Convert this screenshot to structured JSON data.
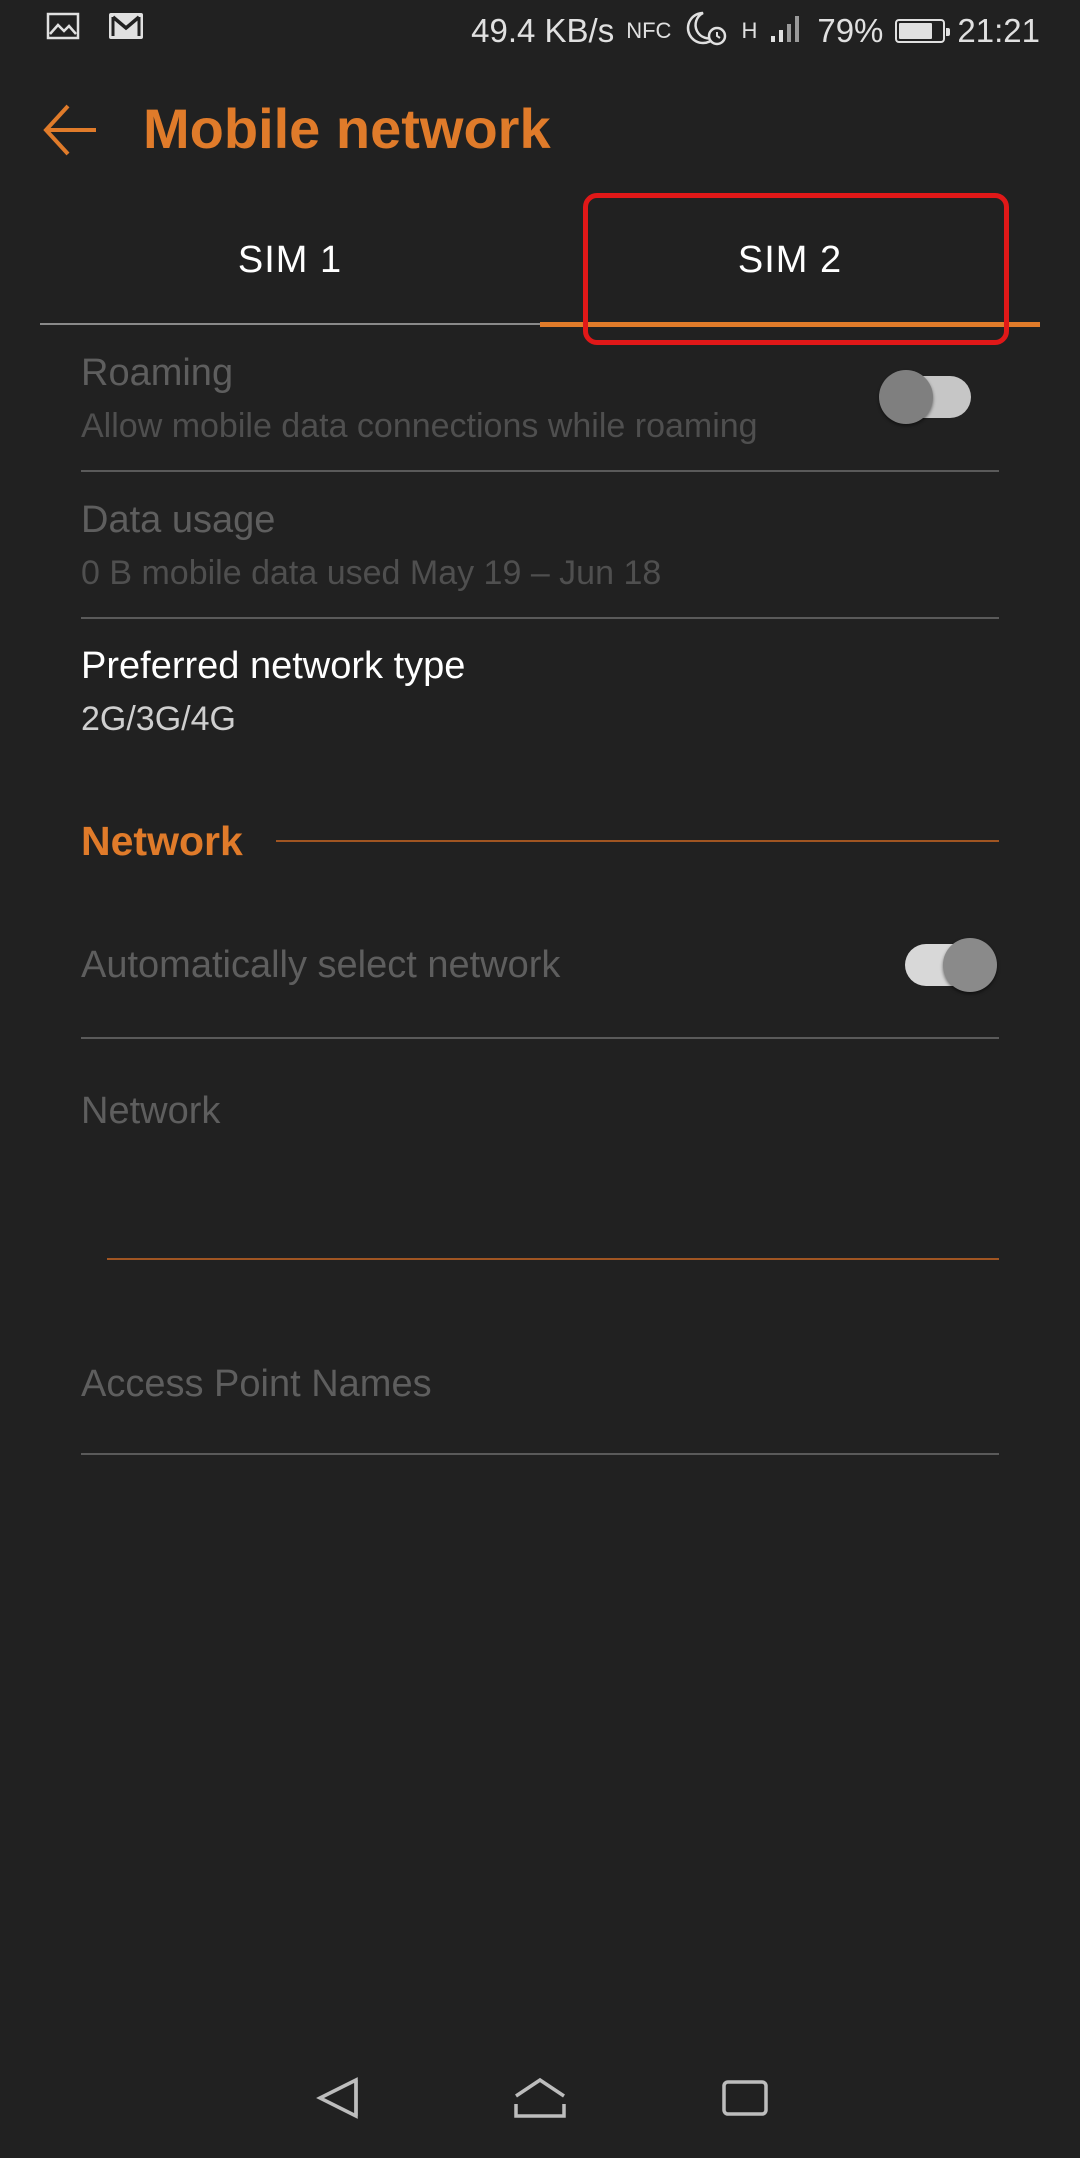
{
  "status_bar": {
    "left_icons": [
      "gallery-icon",
      "gmail-icon"
    ],
    "speed": "49.4 KB/s",
    "nfc_label": "NFC",
    "network_label": "H",
    "battery": "79%",
    "battery_level": 0.79,
    "time": "21:21"
  },
  "app_bar": {
    "title": "Mobile network",
    "back_icon": "arrow-back-icon"
  },
  "tabs": [
    {
      "label": "SIM 1",
      "selected": false
    },
    {
      "label": "SIM 2",
      "selected": true
    }
  ],
  "settings": {
    "roaming": {
      "title": "Roaming",
      "summary": "Allow mobile data connections while roaming",
      "enabled": false,
      "checked": false
    },
    "data_usage": {
      "title": "Data usage",
      "summary": "0 B mobile data used May 19 – Jun 18",
      "enabled": false
    },
    "preferred_network_type": {
      "title": "Preferred network type",
      "summary": "2G/3G/4G",
      "enabled": true
    },
    "network_section": {
      "header": "Network"
    },
    "auto_select_network": {
      "title": "Automatically select network",
      "enabled": false,
      "checked": true
    },
    "network": {
      "title": "Network",
      "enabled": false
    },
    "apn": {
      "title": "Access Point Names",
      "enabled": false
    }
  },
  "colors": {
    "accent": "#e07b2a",
    "background": "#212121",
    "highlight_box": "#e01818"
  },
  "nav_bar": {
    "icons": [
      "back-icon",
      "home-icon",
      "recents-icon"
    ]
  }
}
